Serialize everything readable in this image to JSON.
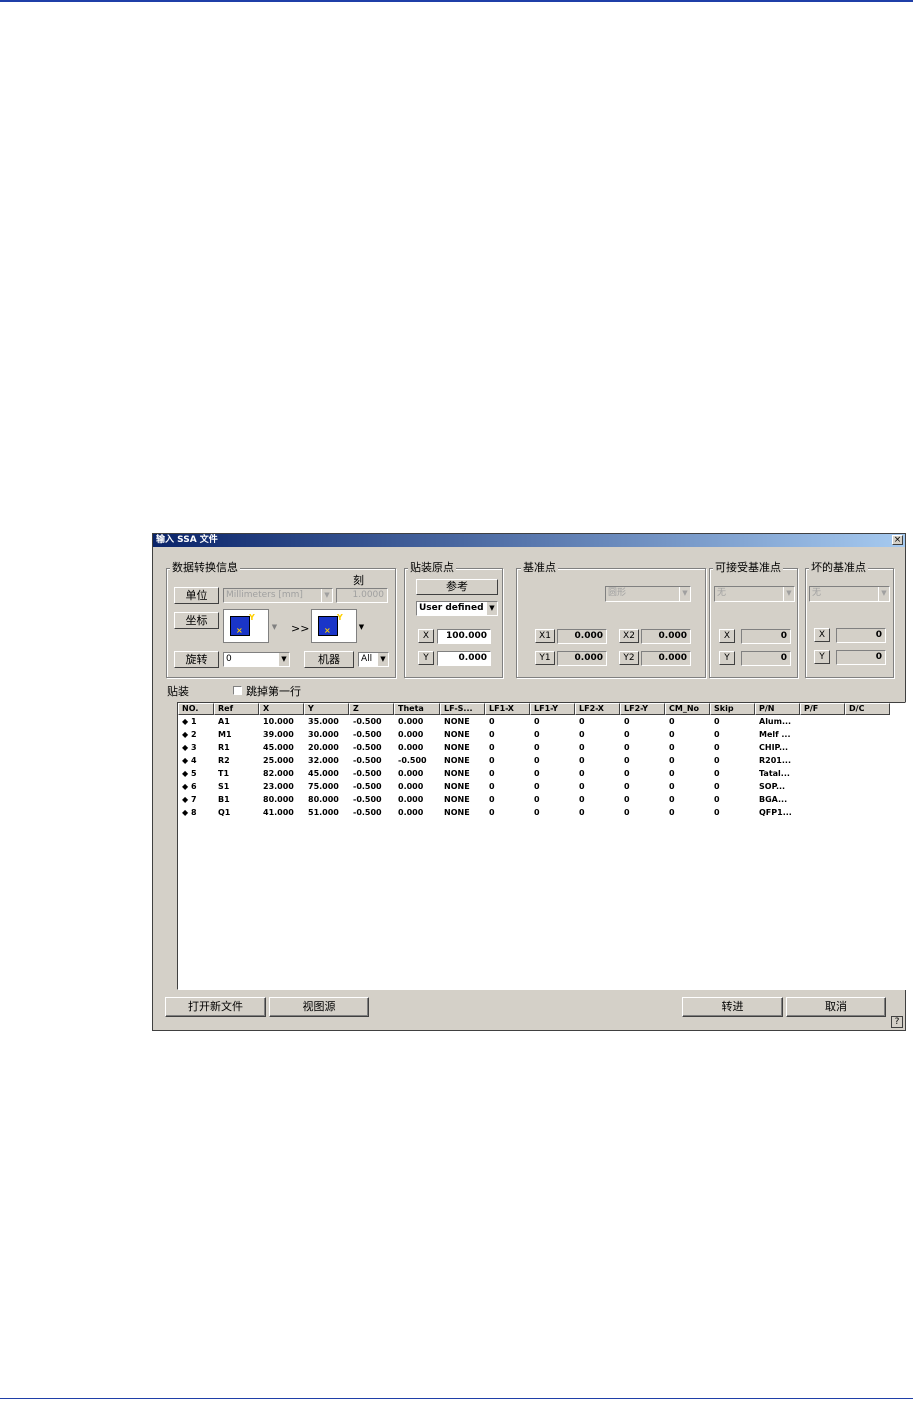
{
  "dialog": {
    "title": "输入 SSA 文件",
    "close_glyph": "×"
  },
  "conversion": {
    "legend": "数据转换信息",
    "unit_label": "单位",
    "unit_value": "Millimeters [mm]",
    "scale_label": "刻",
    "scale_value": "1.0000",
    "coord_label": "坐标",
    "coord_arrow": ">>",
    "rotate_label": "旋转",
    "rotate_value": "0",
    "machine_label": "机器",
    "machine_value": "All"
  },
  "origin": {
    "legend": "贴装原点",
    "ref_label": "参考",
    "ref_value": "User defined",
    "x_label": "X",
    "x_value": "100.000",
    "y_label": "Y",
    "y_value": "0.000"
  },
  "fiducial": {
    "legend": "基准点",
    "shape_value": "圆形",
    "x1_label": "X1",
    "x1_value": "0.000",
    "x2_label": "X2",
    "x2_value": "0.000",
    "y1_label": "Y1",
    "y1_value": "0.000",
    "y2_label": "Y2",
    "y2_value": "0.000"
  },
  "accept_fiducial": {
    "legend": "可接受基准点",
    "value": "无",
    "x_label": "X",
    "x_value": "0",
    "y_label": "Y",
    "y_value": "0"
  },
  "bad_fiducial": {
    "legend": "坏的基准点",
    "value": "无",
    "x_label": "X",
    "x_value": "0",
    "y_label": "Y",
    "y_value": "0"
  },
  "placement": {
    "label": "贴装",
    "skip_first_row_label": "跳掉第一行",
    "skip_first_row_checked": false,
    "columns": [
      "NO.",
      "Ref",
      "X",
      "Y",
      "Z",
      "Theta",
      "LF-S...",
      "LF1-X",
      "LF1-Y",
      "LF2-X",
      "LF2-Y",
      "CM_No",
      "Skip",
      "P/N",
      "P/F",
      "D/C"
    ],
    "rows": [
      [
        "◆ 1",
        "A1",
        "10.000",
        "35.000",
        "-0.500",
        "0.000",
        "NONE",
        "0",
        "0",
        "0",
        "0",
        "0",
        "0",
        "Alum...",
        "",
        ""
      ],
      [
        "◆ 2",
        "M1",
        "39.000",
        "30.000",
        "-0.500",
        "0.000",
        "NONE",
        "0",
        "0",
        "0",
        "0",
        "0",
        "0",
        "Melf ...",
        "",
        ""
      ],
      [
        "◆ 3",
        "R1",
        "45.000",
        "20.000",
        "-0.500",
        "0.000",
        "NONE",
        "0",
        "0",
        "0",
        "0",
        "0",
        "0",
        "CHIP...",
        "",
        ""
      ],
      [
        "◆ 4",
        "R2",
        "25.000",
        "32.000",
        "-0.500",
        "-0.500",
        "NONE",
        "0",
        "0",
        "0",
        "0",
        "0",
        "0",
        "R201...",
        "",
        ""
      ],
      [
        "◆ 5",
        "T1",
        "82.000",
        "45.000",
        "-0.500",
        "0.000",
        "NONE",
        "0",
        "0",
        "0",
        "0",
        "0",
        "0",
        "Tatal...",
        "",
        ""
      ],
      [
        "◆ 6",
        "S1",
        "23.000",
        "75.000",
        "-0.500",
        "0.000",
        "NONE",
        "0",
        "0",
        "0",
        "0",
        "0",
        "0",
        "SOP...",
        "",
        ""
      ],
      [
        "◆ 7",
        "B1",
        "80.000",
        "80.000",
        "-0.500",
        "0.000",
        "NONE",
        "0",
        "0",
        "0",
        "0",
        "0",
        "0",
        "BGA...",
        "",
        ""
      ],
      [
        "◆ 8",
        "Q1",
        "41.000",
        "51.000",
        "-0.500",
        "0.000",
        "NONE",
        "0",
        "0",
        "0",
        "0",
        "0",
        "0",
        "QFP1...",
        "",
        ""
      ]
    ]
  },
  "buttons": {
    "open_new": "打开新文件",
    "view_source": "视图源",
    "proceed": "转进",
    "cancel": "取消",
    "help": "?"
  }
}
